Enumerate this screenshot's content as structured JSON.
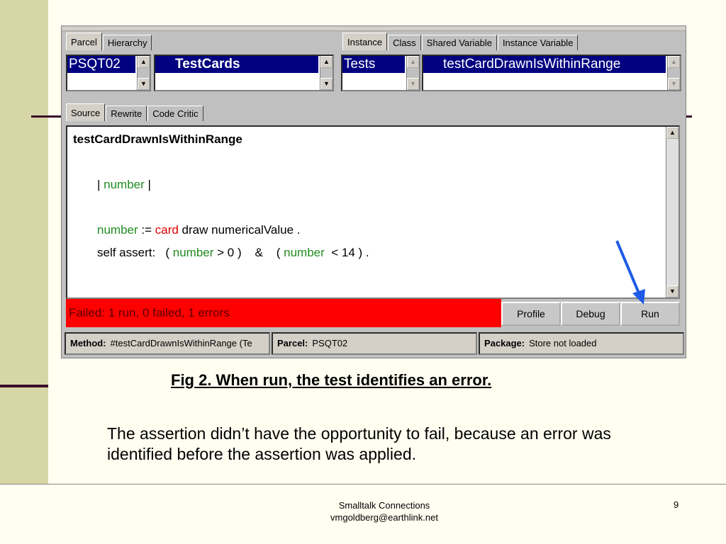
{
  "tabs_left": [
    "Parcel",
    "Hierarchy"
  ],
  "tabs_right": [
    "Instance",
    "Class",
    "Shared Variable",
    "Instance Variable"
  ],
  "lists": {
    "parcel": "PSQT02",
    "class": "TestCards",
    "protocol": "Tests",
    "method": "testCardDrawnIsWithinRange"
  },
  "tabs_source": [
    "Source",
    "Rewrite",
    "Code Critic"
  ],
  "code": {
    "method_name": "testCardDrawnIsWithinRange",
    "l2_bar1": "| ",
    "l2_var": "number",
    "l2_bar2": " |",
    "l3_var": "number",
    "l3_op": " := ",
    "l3_card": "card",
    "l3_rest": " draw numericalValue .",
    "l4_a": "self assert:   ( ",
    "l4_var1": "number",
    "l4_b": " > 0 )    &    ( ",
    "l4_var2": "number",
    "l4_c": "  < 14 ) ."
  },
  "status_text": "Failed: 1 run, 0 failed, 1 errors",
  "buttons": {
    "profile": "Profile",
    "debug": "Debug",
    "run": "Run"
  },
  "info": {
    "method_label": "Method:",
    "method_value": "#testCardDrawnIsWithinRange (Te",
    "parcel_label": "Parcel:",
    "parcel_value": "PSQT02",
    "package_label": "Package:",
    "package_value": "Store not loaded"
  },
  "caption": "Fig 2.  When run, the test identifies an error.",
  "body_text": "The assertion didn’t have the opportunity to fail, because an error was identified before the assertion was applied.",
  "footer": {
    "line1": "Smalltalk Connections",
    "line2": "vmgoldberg@earthlink.net",
    "page": "9"
  },
  "colors": {
    "status_bg": "#ff0000",
    "selection_bg": "#000080",
    "arrow": "#1e5be6",
    "sidebar": "#d6d6a6"
  }
}
